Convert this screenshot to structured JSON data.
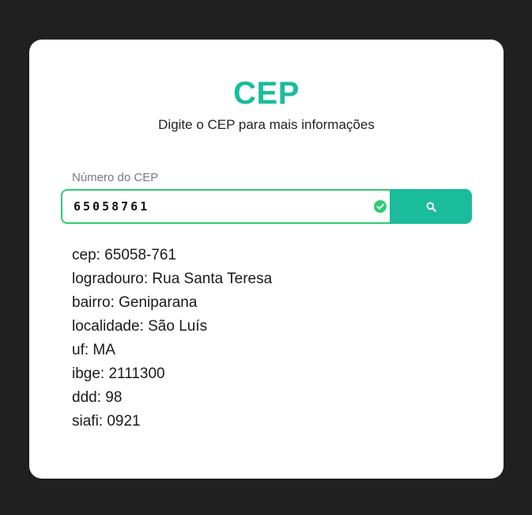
{
  "header": {
    "title": "CEP",
    "subtitle": "Digite o CEP para mais informações"
  },
  "form": {
    "label": "Número do CEP",
    "cep_value": "65058761",
    "valid": true,
    "search_icon": "search-icon"
  },
  "results": [
    "cep: 65058-761",
    "logradouro: Rua Santa Teresa",
    "bairro: Geniparana",
    "localidade: São Luís",
    "uf: MA",
    "ibge: 2111300",
    "ddd: 98",
    "siafi: 0921"
  ],
  "colors": {
    "accent": "#1abc9c",
    "valid": "#2ecc71",
    "background": "#202020"
  }
}
